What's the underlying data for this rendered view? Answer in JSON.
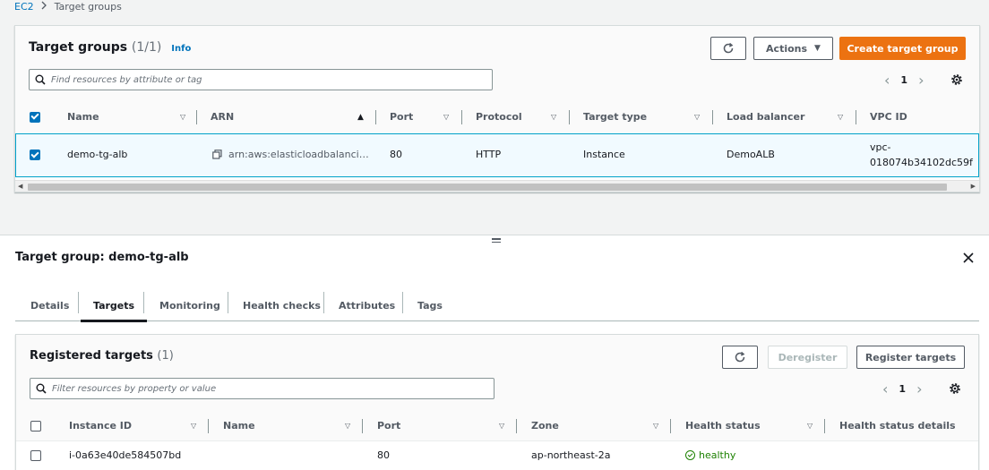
{
  "breadcrumb": {
    "root": "EC2",
    "current": "Target groups"
  },
  "top": {
    "title": "Target groups",
    "count": "(1/1)",
    "info": "Info",
    "actions_label": "Actions",
    "create_label": "Create target group",
    "search_placeholder": "Find resources by attribute or tag",
    "page": "1",
    "columns": [
      "Name",
      "ARN",
      "Port",
      "Protocol",
      "Target type",
      "Load balancer",
      "VPC ID"
    ],
    "rows": [
      {
        "name": "demo-tg-alb",
        "arn": "arn:aws:elasticloadbalanci…",
        "port": "80",
        "protocol": "HTTP",
        "target_type": "Instance",
        "load_balancer": "DemoALB",
        "vpc_line1": "vpc-",
        "vpc_line2": "018074b34102dc59f",
        "selected": true
      }
    ]
  },
  "detail": {
    "title": "Target group: demo-tg-alb",
    "tabs": [
      "Details",
      "Targets",
      "Monitoring",
      "Health checks",
      "Attributes",
      "Tags"
    ],
    "active_tab": "Targets",
    "registered": {
      "title": "Registered targets",
      "count": "(1)",
      "deregister_label": "Deregister",
      "register_label": "Register targets",
      "search_placeholder": "Filter resources by property or value",
      "page": "1",
      "columns": [
        "Instance ID",
        "Name",
        "Port",
        "Zone",
        "Health status",
        "Health status details"
      ],
      "rows": [
        {
          "instance_id": "i-0a63e40de584507bd",
          "name": "",
          "port": "80",
          "zone": "ap-northeast-2a",
          "health": "healthy",
          "details": ""
        }
      ]
    }
  },
  "colors": {
    "link": "#0073bb",
    "primary": "#ec7211",
    "healthy": "#1d8102",
    "selected_border": "#00a1c9"
  }
}
